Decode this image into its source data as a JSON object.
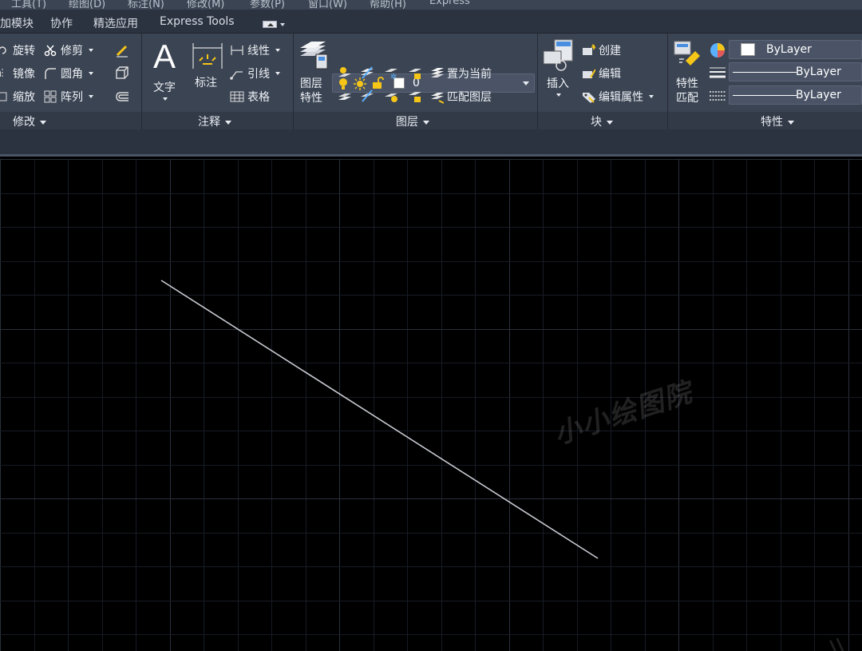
{
  "menu": [
    "工具(T)",
    "绘图(D)",
    "标注(N)",
    "修改(M)",
    "参数(P)",
    "窗口(W)",
    "帮助(H)",
    "Express"
  ],
  "tabs": [
    "加模块",
    "协作",
    "精选应用",
    "Express Tools"
  ],
  "panels": {
    "modify": {
      "title": "修改",
      "rotate": "旋转",
      "trim": "修剪",
      "mirror": "镜像",
      "fillet": "圆角",
      "scale": "缩放",
      "array": "阵列"
    },
    "annotation": {
      "title": "注释",
      "text": "文字",
      "dimension": "标注",
      "linear": "线性",
      "leader": "引线",
      "table": "表格"
    },
    "layers": {
      "title": "图层",
      "layer_properties": "图层\n特性",
      "current_layer": "0",
      "set_current": "置为当前",
      "match_layer": "匹配图层"
    },
    "block": {
      "title": "块",
      "insert": "插入",
      "create": "创建",
      "edit": "编辑",
      "edit_attributes": "编辑属性"
    },
    "properties": {
      "title": "特性",
      "match_properties": "特性\n匹配",
      "color": "ByLayer",
      "linetype": "ByLayer",
      "lineweight": "ByLayer"
    }
  },
  "watermark": "小小绘图院",
  "colors": {
    "ribbon": "#3b4453",
    "canvas": "#000000",
    "grid": "#1e2430",
    "line": "#c8cbd2",
    "accent_yellow": "#f5c518"
  }
}
